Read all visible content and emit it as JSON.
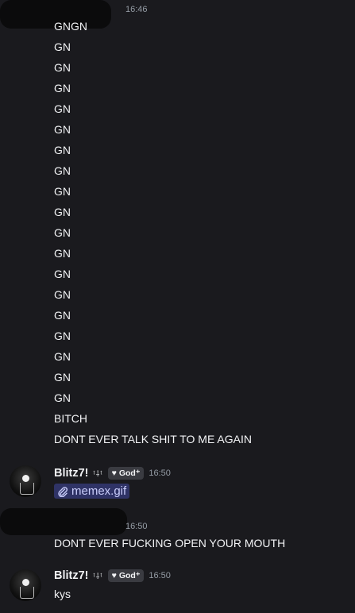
{
  "group1": {
    "timestamp": "16:46",
    "lines": [
      "GNGN",
      "GN",
      "GN",
      "GN",
      "GN",
      "GN",
      "GN",
      "GN",
      "GN",
      "GN",
      "GN",
      "GN",
      "GN",
      "GN",
      "GN",
      "GN",
      "GN",
      "GN",
      "GN",
      "BITCH",
      "DONT EVER TALK SHIT TO ME AGAIN"
    ]
  },
  "blitz_msg1": {
    "username": "Blitz7!",
    "deco": "ᵗ⸸ᵗ",
    "badge": "God⁺",
    "timestamp": "16:50",
    "attachment": "memex.gif"
  },
  "group2": {
    "timestamp": "16:50",
    "text": "DONT EVER FUCKING OPEN YOUR MOUTH"
  },
  "blitz_msg2": {
    "username": "Blitz7!",
    "deco": "ᵗ⸸ᵗ",
    "badge": "God⁺",
    "timestamp": "16:50",
    "text": "kys"
  },
  "colors": {
    "background": "#1a1a1e",
    "link": "#c9cdfb",
    "attachment_bg": "#2f3366",
    "timestamp": "#949ba4"
  }
}
